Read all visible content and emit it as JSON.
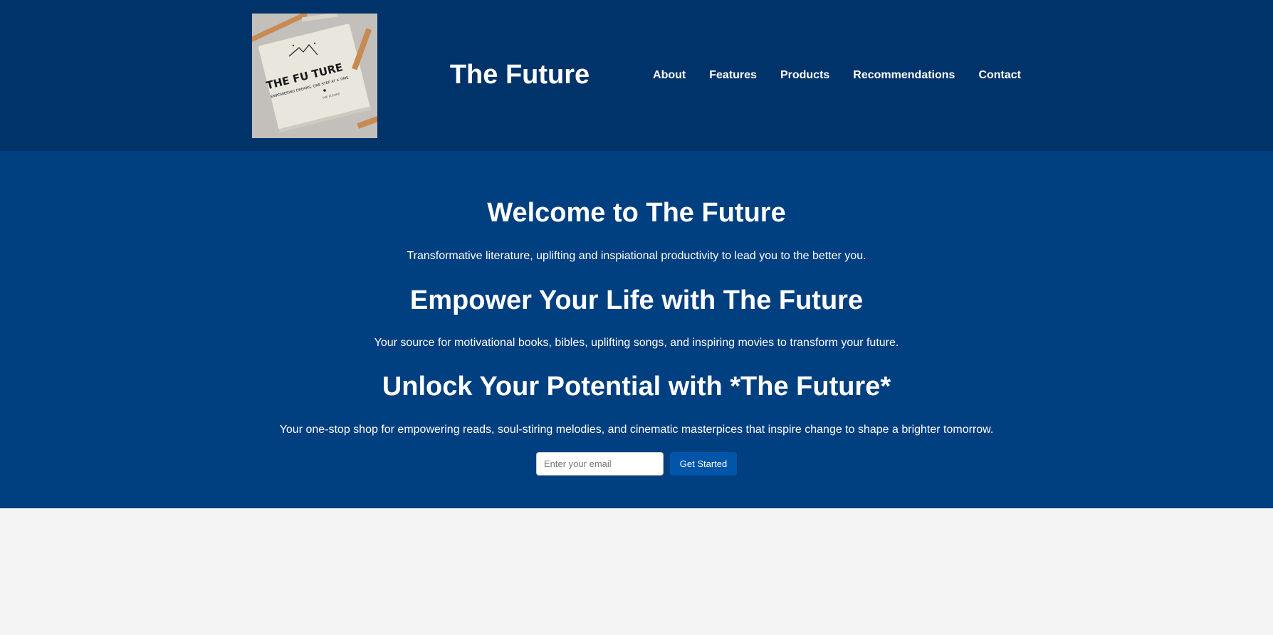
{
  "header": {
    "logo": {
      "title": "THE FU TURE",
      "tagline": "EMPOWERING DREAMS, ONE STEP AT A TIME",
      "small_text": "THE FUTURE"
    },
    "site_title": "The Future",
    "nav": [
      {
        "label": "About"
      },
      {
        "label": "Features"
      },
      {
        "label": "Products"
      },
      {
        "label": "Recommendations"
      },
      {
        "label": "Contact"
      }
    ]
  },
  "hero": {
    "welcome_heading": "Welcome to The Future",
    "welcome_text": "Transformative literature, uplifting and inspiational productivity to lead you to the better you.",
    "empower_heading": "Empower Your Life with The Future",
    "empower_text": "Your source for motivational books, bibles, uplifting songs, and inspiring movies to transform your future.",
    "unlock_heading": "Unlock Your Potential with *The Future*",
    "unlock_text": "Your one-stop shop for empowering reads, soul-stiring melodies, and cinematic masterpices that inspire change to shape a brighter tomorrow.",
    "email_input": {
      "value": "",
      "placeholder": "Enter your email"
    },
    "cta_label": "Get Started"
  },
  "colors": {
    "header_bg": "#00336a",
    "hero_bg": "#003f80",
    "button_bg": "#0055a8",
    "page_bg": "#f4f4f4"
  }
}
